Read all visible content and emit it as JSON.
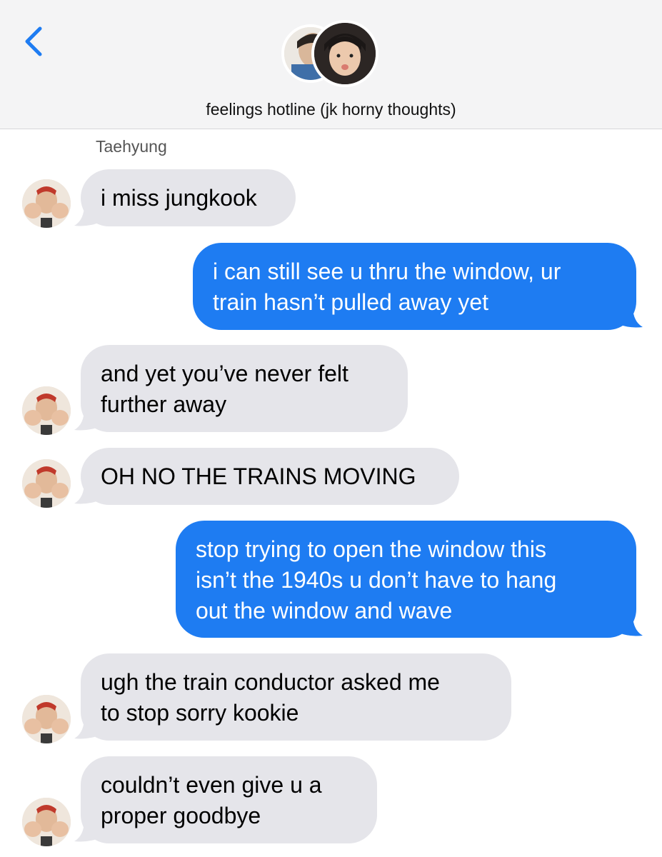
{
  "header": {
    "back_icon": "chevron-left-icon",
    "title": "feelings hotline (jk horny thoughts)",
    "accent": "#1e7cf2"
  },
  "thread": {
    "sender_name": "Taehyung",
    "messages": [
      {
        "dir": "in",
        "text": "i miss jungkook"
      },
      {
        "dir": "out",
        "text": "i can still see u thru the window, ur\ntrain hasn’t pulled away yet"
      },
      {
        "dir": "in",
        "text": "and yet you’ve never felt\nfurther away"
      },
      {
        "dir": "in",
        "text": "OH NO THE TRAINS MOVING"
      },
      {
        "dir": "out",
        "text": "stop trying to open the window this\nisn’t the 1940s u don’t have to hang\nout the window and wave"
      },
      {
        "dir": "in",
        "text": "ugh the train conductor asked me\nto stop sorry kookie"
      },
      {
        "dir": "in",
        "text": "couldn’t even give u a\nproper goodbye"
      }
    ]
  },
  "colors": {
    "incoming_bubble": "#e5e5ea",
    "outgoing_bubble": "#1e7cf2",
    "header_bg": "#f4f4f5"
  }
}
